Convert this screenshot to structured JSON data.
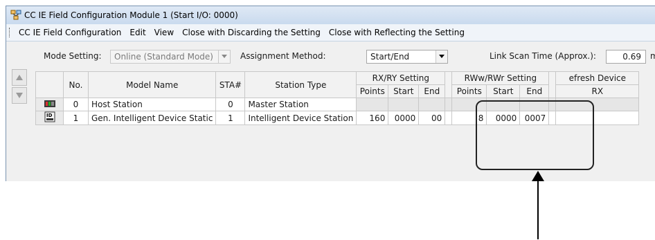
{
  "window": {
    "title": "CC IE Field Configuration Module 1 (Start I/O: 0000)"
  },
  "menu": [
    "CC IE Field Configuration",
    "Edit",
    "View",
    "Close with Discarding the Setting",
    "Close with Reflecting the Setting"
  ],
  "controls": {
    "mode_label": "Mode Setting:",
    "mode_value": "Online (Standard Mode)",
    "assign_label": "Assignment Method:",
    "assign_value": "Start/End",
    "link_scan_label": "Link Scan Time (Approx.):",
    "link_scan_value": "0.69",
    "link_scan_unit": "m"
  },
  "table": {
    "headers": {
      "no": "No.",
      "model": "Model Name",
      "sta": "STA#",
      "type": "Station Type",
      "rxry": "RX/RY Setting",
      "rwwrwr": "RWw/RWr Setting",
      "refresh": "efresh Device",
      "points": "Points",
      "start": "Start",
      "end": "End",
      "rx": "RX"
    },
    "rows": [
      {
        "icon": "host-station-icon",
        "no": "0",
        "model": "Host Station",
        "sta": "0",
        "type": "Master Station",
        "rx_points": "",
        "rx_start": "",
        "rx_end": "",
        "rw_points": "",
        "rw_start": "",
        "rw_end": "",
        "refresh_rx": ""
      },
      {
        "icon": "intelligent-device-icon",
        "no": "1",
        "model": "Gen. Intelligent Device Static",
        "sta": "1",
        "type": "Intelligent Device Station",
        "rx_points": "160",
        "rx_start": "0000",
        "rx_end": "00",
        "rw_points": "8",
        "rw_start": "0000",
        "rw_end": "0007",
        "refresh_rx": ""
      }
    ]
  },
  "colors": {
    "window_frame": "#b9d1ea",
    "highlight": "#222222"
  }
}
